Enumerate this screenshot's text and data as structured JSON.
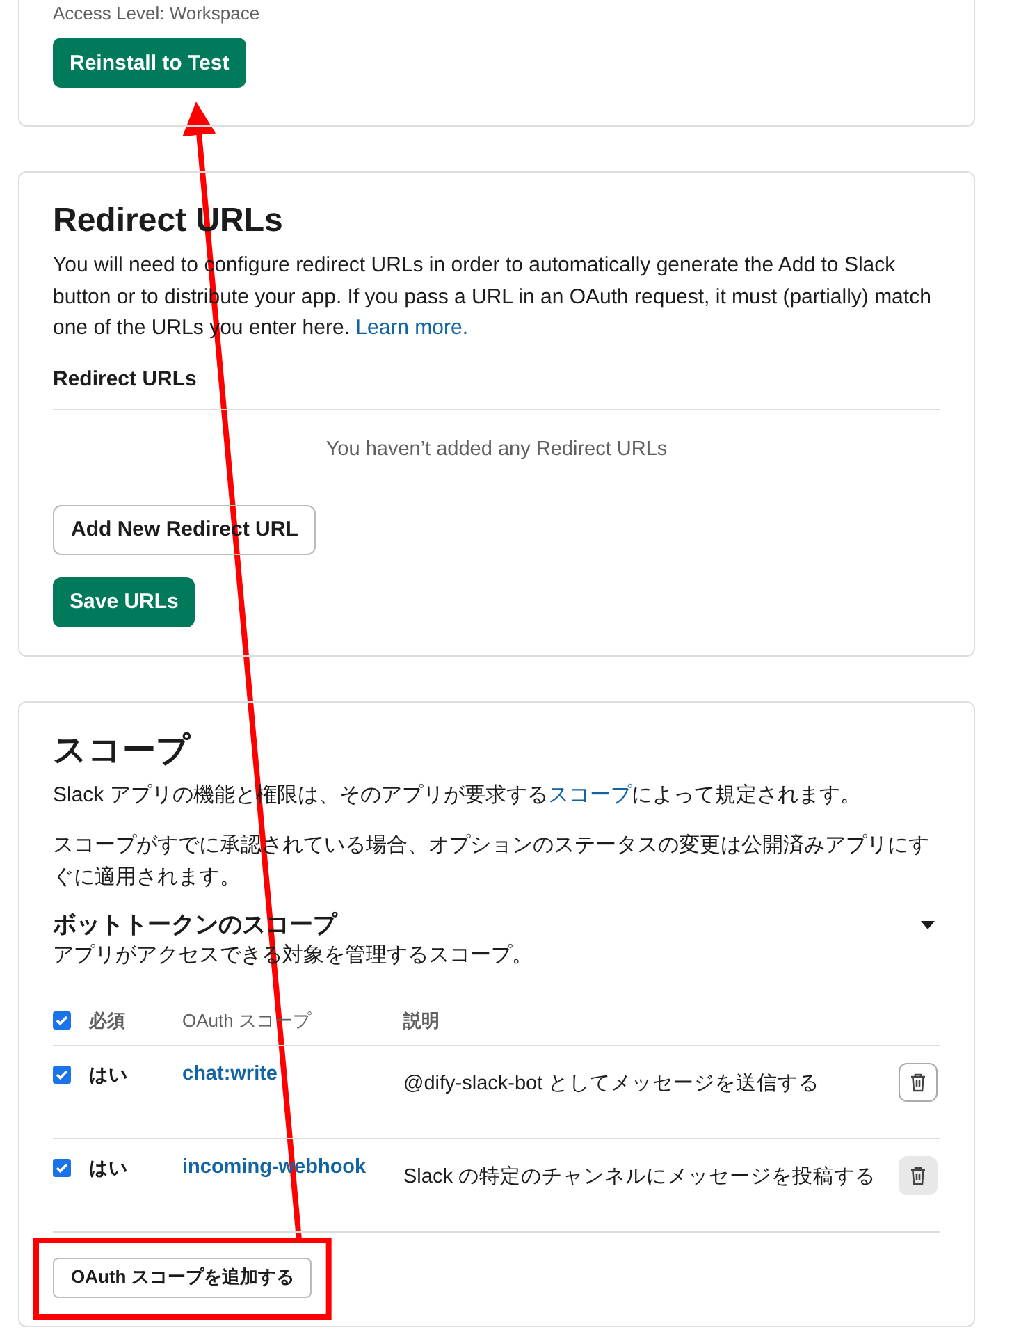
{
  "install_card": {
    "access_level": "Access Level: Workspace",
    "reinstall_button": "Reinstall to Test"
  },
  "redirect_card": {
    "title": "Redirect URLs",
    "description": "You will need to configure redirect URLs in order to automatically generate the Add to Slack button or to distribute your app. If you pass a URL in an OAuth request, it must (partially) match one of the URLs you enter here.",
    "learn_more": "Learn more.",
    "list_heading": "Redirect URLs",
    "empty_text": "You haven’t added any Redirect URLs",
    "add_button": "Add New Redirect URL",
    "save_button": "Save URLs"
  },
  "scopes_card": {
    "title": "スコープ",
    "intro_before": "Slack アプリの機能と権限は、そのアプリが要求する",
    "intro_link": "スコープ",
    "intro_after": "によって規定されます。",
    "note": "スコープがすでに承認されている場合、オプションのステータスの変更は公開済みアプリにすぐに適用されます。",
    "bot_section": {
      "title": "ボットトークンのスコープ",
      "expanded": true,
      "subtitle": "アプリがアクセスできる対象を管理するスコープ。",
      "columns": {
        "all_checked": true,
        "required": "必須",
        "scope": "OAuth スコープ",
        "description": "説明"
      },
      "rows": [
        {
          "checked": true,
          "required": "はい",
          "scope": "chat:write",
          "description": "@dify-slack-bot としてメッセージを送信する",
          "highlighted": false
        },
        {
          "checked": true,
          "required": "はい",
          "scope": "incoming-webhook",
          "description": "Slack の特定のチャンネルにメッセージを投稿する",
          "highlighted": true
        }
      ],
      "add_button": "OAuth スコープを追加する"
    }
  }
}
